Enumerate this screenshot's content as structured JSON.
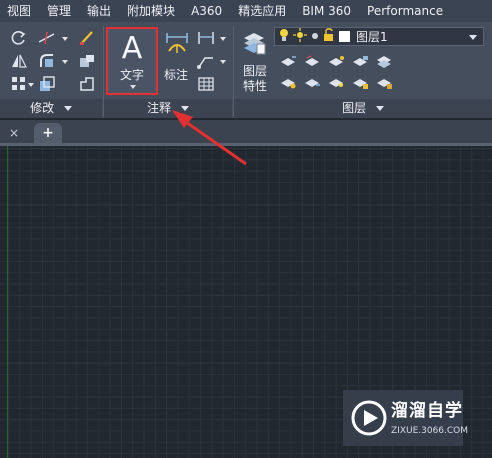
{
  "menu": [
    "视图",
    "管理",
    "输出",
    "附加模块",
    "A360",
    "精选应用",
    "BIM 360",
    "Performance"
  ],
  "ribbon": {
    "panels": {
      "modify": "修改",
      "annotation": "注释",
      "layers": "图层"
    },
    "text_button_label": "文字",
    "text_button_glyph": "A",
    "dimension_label": "标注",
    "layer_props_label_1": "图层",
    "layer_props_label_2": "特性",
    "layer_combo_value": "图层1"
  },
  "tabs": {
    "close_glyph": "×",
    "new_tab_glyph": "+"
  },
  "watermark": {
    "brand": "溜溜自学",
    "url": "ZIXUE.3066.COM"
  },
  "colors": {
    "highlight": "#e33030",
    "accent_yellow": "#f2c230"
  }
}
